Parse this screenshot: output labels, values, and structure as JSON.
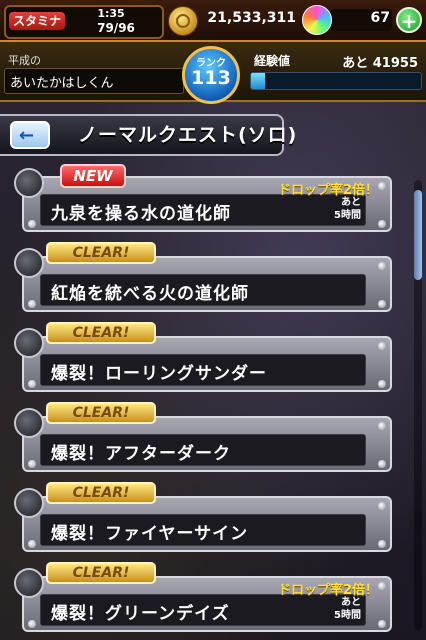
{
  "status": {
    "stamina_label": "スタミナ",
    "stamina_timer": "1:35",
    "stamina_value": "79/96",
    "coins": "21,533,311",
    "orbs": "67",
    "plus_label": "+"
  },
  "player": {
    "prefix": "平成の",
    "name": "あいたかはしくん",
    "rank_label": "ランク",
    "rank": "113",
    "exp_label": "経験値",
    "exp_remaining": "あと 41955",
    "exp_progress": 0.08
  },
  "header": {
    "back_icon": "←",
    "title": "ノーマルクエスト(ソロ)"
  },
  "quests": [
    {
      "badge": "NEW",
      "name": "九泉を操る水の道化師",
      "drop": "ドロップ率2倍！",
      "time_line1": "あと",
      "time_line2": "5時間"
    },
    {
      "badge": "CLEAR!",
      "name": "紅焔を統べる火の道化師",
      "drop": "",
      "time_line1": "",
      "time_line2": ""
    },
    {
      "badge": "CLEAR!",
      "name": "爆裂！ローリングサンダー",
      "drop": "",
      "time_line1": "",
      "time_line2": ""
    },
    {
      "badge": "CLEAR!",
      "name": "爆裂！アフターダーク",
      "drop": "",
      "time_line1": "",
      "time_line2": ""
    },
    {
      "badge": "CLEAR!",
      "name": "爆裂！ファイヤーサイン",
      "drop": "",
      "time_line1": "",
      "time_line2": ""
    },
    {
      "badge": "CLEAR!",
      "name": "爆裂！グリーンデイズ",
      "drop": "ドロップ率2倍！",
      "time_line1": "あと",
      "time_line2": "5時間"
    }
  ],
  "colors": {
    "accent_gold": "#f0c050",
    "stamina_red": "#e0403a",
    "new_red": "#c81010",
    "clear_gold": "#c89020",
    "drop_yellow": "#ffe040"
  }
}
